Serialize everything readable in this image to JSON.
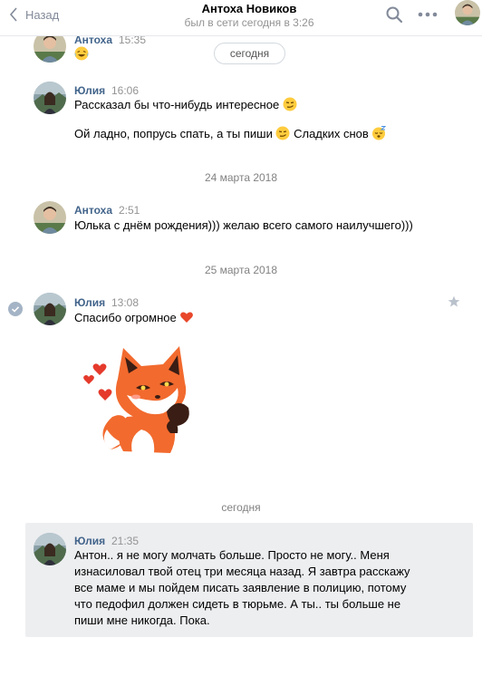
{
  "header": {
    "back_label": "Назад",
    "peer_name": "Антоха Новиков",
    "peer_status": "был в сети сегодня в 3:26"
  },
  "today_pill": "сегодня",
  "messages": [
    {
      "author": "Антоха",
      "time": "15:35",
      "text": ""
    },
    {
      "author": "Юлия",
      "time": "16:06",
      "text1": "Рассказал бы что-нибудь интересное",
      "text2a": "Ой ладно, попрусь спать, а ты пиши",
      "text2b": "Сладких снов"
    },
    {
      "author": "Антоха",
      "time": "2:51",
      "text": "Юлька с днём рождения))) желаю всего самого наилучшего)))"
    },
    {
      "author": "Юлия",
      "time": "13:08",
      "text": "Спасибо огромное"
    },
    {
      "author": "Юлия",
      "time": "21:35",
      "text": "Антон.. я не могу молчать больше. Просто не могу.. Меня изнасиловал твой отец три месяца назад. Я завтра расскажу все маме и мы пойдем писать заявление в полицию, потому что педофил должен сидеть в тюрьме. А ты.. ты больше не пиши мне никогда. Пока."
    }
  ],
  "date_separators": [
    "24 марта 2018",
    "25 марта 2018",
    "сегодня"
  ],
  "icons": {
    "back": "chevron-left-icon",
    "search": "search-icon",
    "more": "more-icon",
    "read": "check-icon",
    "star": "star-icon"
  },
  "colors": {
    "author": "#42648b",
    "highlight": "#edeef0"
  }
}
